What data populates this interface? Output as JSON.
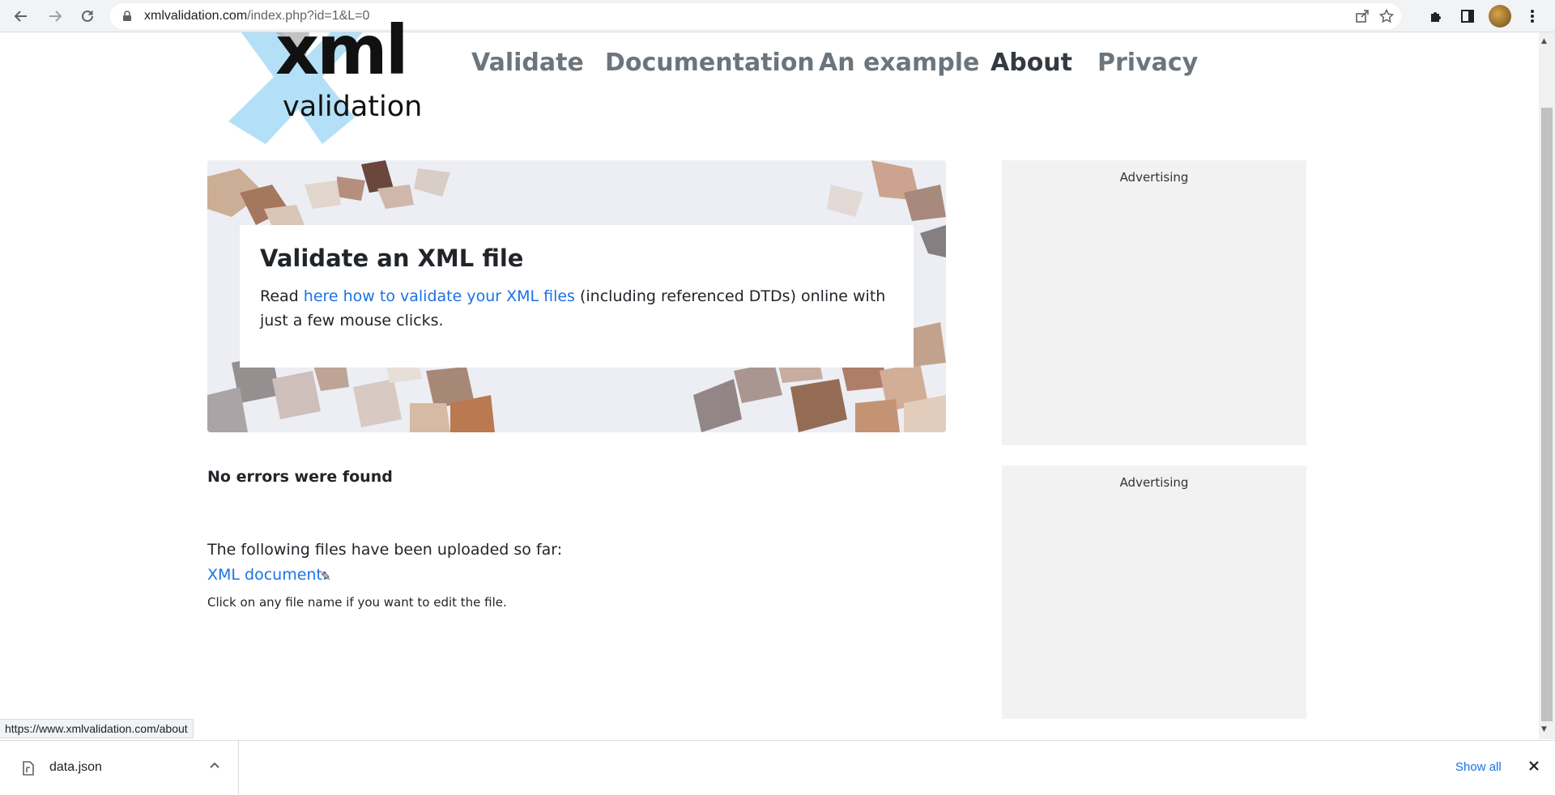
{
  "browser": {
    "url_host": "xmlvalidation.com",
    "url_path": "/index.php?id=1&L=0",
    "back_icon": "back-arrow-icon",
    "forward_icon": "forward-arrow-icon",
    "reload_icon": "reload-icon"
  },
  "logo": {
    "text_top": "xml",
    "text_bottom": "validation",
    "accent_color": "#b3e0f7"
  },
  "nav": {
    "items": [
      {
        "label": "Validate"
      },
      {
        "label": "Documentation"
      },
      {
        "label": "An example"
      },
      {
        "label": "About"
      },
      {
        "label": "Privacy"
      }
    ],
    "active": "About"
  },
  "hero": {
    "title": "Validate an XML file",
    "text_before": "Read ",
    "link_text": "here how to validate your XML files",
    "text_after": " (including referenced DTDs) online with just a few mouse clicks."
  },
  "result": {
    "status": "No errors were found",
    "uploaded_intro": "The following files have been uploaded so far:",
    "file_link": "XML document:",
    "hint": "Click on any file name if you want to edit the file."
  },
  "ads": [
    {
      "label": "Advertising"
    },
    {
      "label": "Advertising"
    }
  ],
  "status_bar": {
    "url": "https://www.xmlvalidation.com/about"
  },
  "downloads": {
    "file_name": "data.json",
    "show_all": "Show all"
  },
  "colors": {
    "link": "#1a73e8",
    "nav_inactive": "#6c757d",
    "nav_active": "#343a40",
    "ad_background": "#f2f2f2"
  }
}
